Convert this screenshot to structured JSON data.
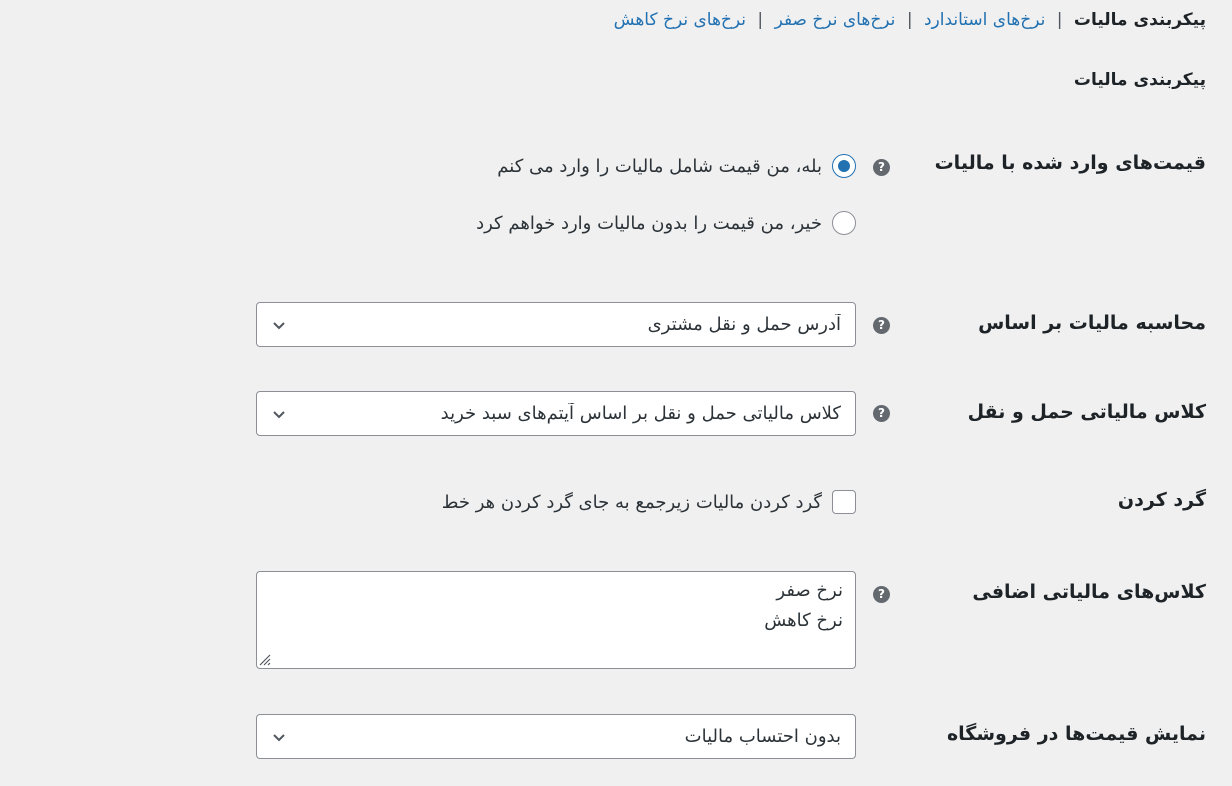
{
  "nav": {
    "current": "پیکربندی مالیات",
    "links": [
      "نرخ‌های استاندارد",
      "نرخ‌های نرخ صفر",
      "نرخ‌های نرخ کاهش"
    ],
    "separator": "|"
  },
  "section_title": "پیکربندی مالیات",
  "prices_entered": {
    "label": "قیمت‌های وارد شده با مالیات",
    "options": [
      {
        "label": "بله، من قیمت شامل مالیات را وارد می کنم",
        "checked": true
      },
      {
        "label": "خیر، من قیمت را بدون مالیات وارد خواهم کرد",
        "checked": false
      }
    ]
  },
  "calc_based_on": {
    "label": "محاسبه مالیات بر اساس",
    "value": "آدرس حمل و نقل مشتری"
  },
  "shipping_tax_class": {
    "label": "کلاس مالیاتی حمل و نقل",
    "value": "کلاس مالیاتی حمل و نقل بر اساس آیتم‌های سبد خرید"
  },
  "rounding": {
    "label": "گرد کردن",
    "checkbox_label": "گرد کردن مالیات زیرجمع به جای گرد کردن هر خط",
    "checked": false
  },
  "additional_classes": {
    "label": "کلاس‌های مالیاتی اضافی",
    "lines": [
      "نرخ صفر",
      "نرخ کاهش"
    ]
  },
  "display_prices_shop": {
    "label": "نمایش قیمت‌ها در فروشگاه",
    "value": "بدون احتساب مالیات"
  },
  "help_glyph": "?",
  "colors": {
    "link": "#2271b1",
    "background": "#f0f0f1",
    "help_icon": "#646970",
    "accent": "#2271b1"
  }
}
